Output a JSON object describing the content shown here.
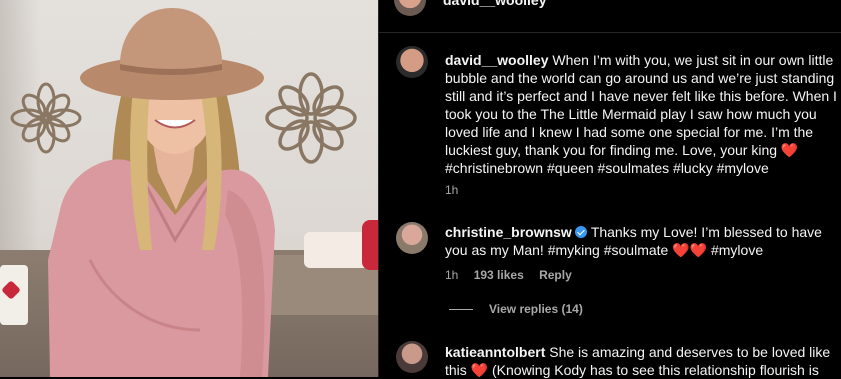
{
  "top": {
    "username": "david__woolley"
  },
  "comments": [
    {
      "username": "david__woolley",
      "text": "When I’m with you, we just sit in our own little bubble and the world can go around us and we’re just standing still and it’s perfect and I have never felt like this before. When I took you to the The Little Mermaid play I saw how much you loved life and I knew I had some one special for me. I’m the luckiest guy, thank you for finding me. Love, your king",
      "heart": "❤️",
      "tags": "#christinebrown #queen #soulmates #lucky #mylove",
      "time": "1h"
    },
    {
      "username": "christine_brownsw",
      "text": "Thanks my Love! I’m blessed to have you as my Man! #myking #soulmate",
      "hearts": "❤️❤️",
      "tags": "#mylove",
      "time": "1h",
      "likes": "193 likes",
      "reply": "Reply",
      "view_replies": "View replies (14)"
    },
    {
      "username": "katieanntolbert",
      "text": "She is amazing and deserves to be loved like",
      "cut_line": "this ❤️ (Knowing Kody has to see this relationship flourish is"
    }
  ]
}
